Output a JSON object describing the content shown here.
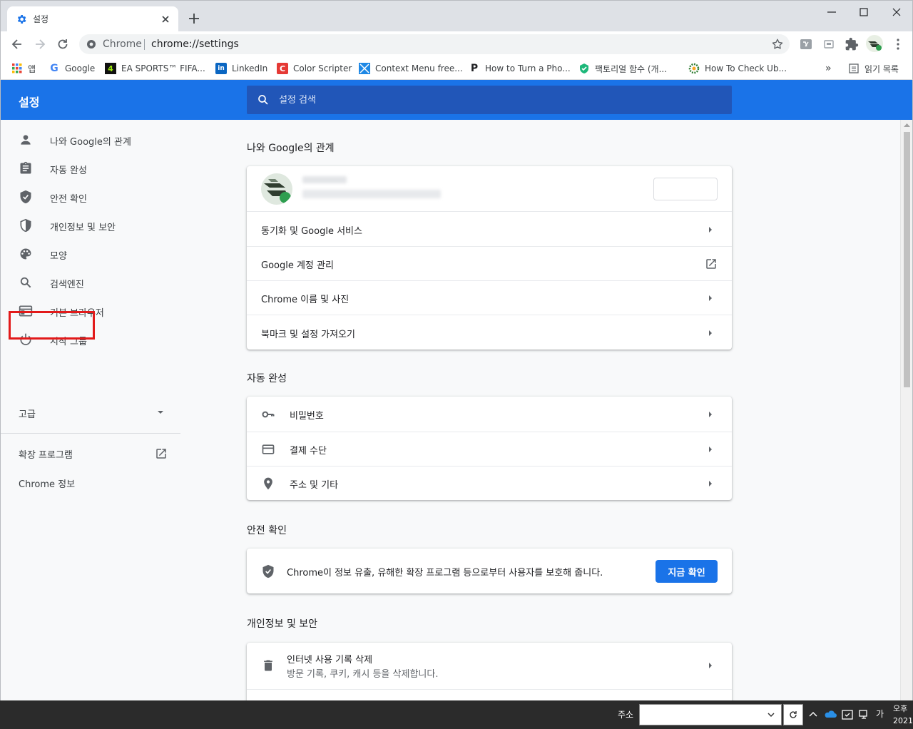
{
  "tab": {
    "title": "설정"
  },
  "omnibox": {
    "scheme_label": "Chrome",
    "url": "chrome://settings"
  },
  "bookmarks": [
    {
      "label": "앱",
      "icon": "apps-grid-icon"
    },
    {
      "label": "Google",
      "icon": "google-icon"
    },
    {
      "label": "EA SPORTS™ FIFA...",
      "icon": "ea-sports-icon"
    },
    {
      "label": "LinkedIn",
      "icon": "linkedin-icon"
    },
    {
      "label": "Color Scripter",
      "icon": "color-scripter-icon"
    },
    {
      "label": "Context Menu free...",
      "icon": "context-menu-icon"
    },
    {
      "label": "How to Turn a Pho...",
      "icon": "p-icon"
    },
    {
      "label": "팩토리얼 함수 (개...",
      "icon": "green-shield-icon"
    },
    {
      "label": "How To Check Ub...",
      "icon": "gear-icon"
    }
  ],
  "bookmarks_overflow": "»",
  "reading_list": "읽기 목록",
  "header": {
    "title": "설정",
    "search_placeholder": "설정 검색"
  },
  "sidebar": {
    "items": [
      {
        "label": "나와 Google의 관계",
        "icon": "person-icon"
      },
      {
        "label": "자동 완성",
        "icon": "clipboard-icon"
      },
      {
        "label": "안전 확인",
        "icon": "shield-check-icon"
      },
      {
        "label": "개인정보 및 보안",
        "icon": "shield-half-icon"
      },
      {
        "label": "모양",
        "icon": "palette-icon"
      },
      {
        "label": "검색엔진",
        "icon": "search-icon"
      },
      {
        "label": "기본 브라우저",
        "icon": "browser-window-icon"
      },
      {
        "label": "시작 그룹",
        "icon": "power-icon"
      }
    ],
    "advanced": "고급",
    "extensions": "확장 프로그램",
    "about": "Chrome 정보"
  },
  "sections": {
    "you_and_google": {
      "title": "나와 Google의 관계",
      "account_name": "",
      "account_email": "",
      "sync_button": "",
      "rows": [
        "동기화 및 Google 서비스",
        "Google 계정 관리",
        "Chrome 이름 및 사진",
        "북마크 및 설정 가져오기"
      ]
    },
    "autofill": {
      "title": "자동 완성",
      "rows": [
        "비밀번호",
        "결제 수단",
        "주소 및 기타"
      ]
    },
    "safety_check": {
      "title": "안전 확인",
      "description": "Chrome이 정보 유출, 유해한 확장 프로그램 등으로부터 사용자를 보호해 줍니다.",
      "button": "지금 확인"
    },
    "privacy": {
      "title": "개인정보 및 보안",
      "rows": [
        {
          "label": "인터넷 사용 기록 삭제",
          "sublabel": "방문 기록, 쿠키, 캐시 등을 삭제합니다."
        }
      ]
    }
  },
  "taskbar": {
    "address_label": "주소",
    "ime": "가",
    "clock_line1": "오후",
    "clock_line2": "2021"
  },
  "colors": {
    "accent": "#1a73e8",
    "header": "#1a73e8",
    "highlight": "#e21a1a"
  }
}
